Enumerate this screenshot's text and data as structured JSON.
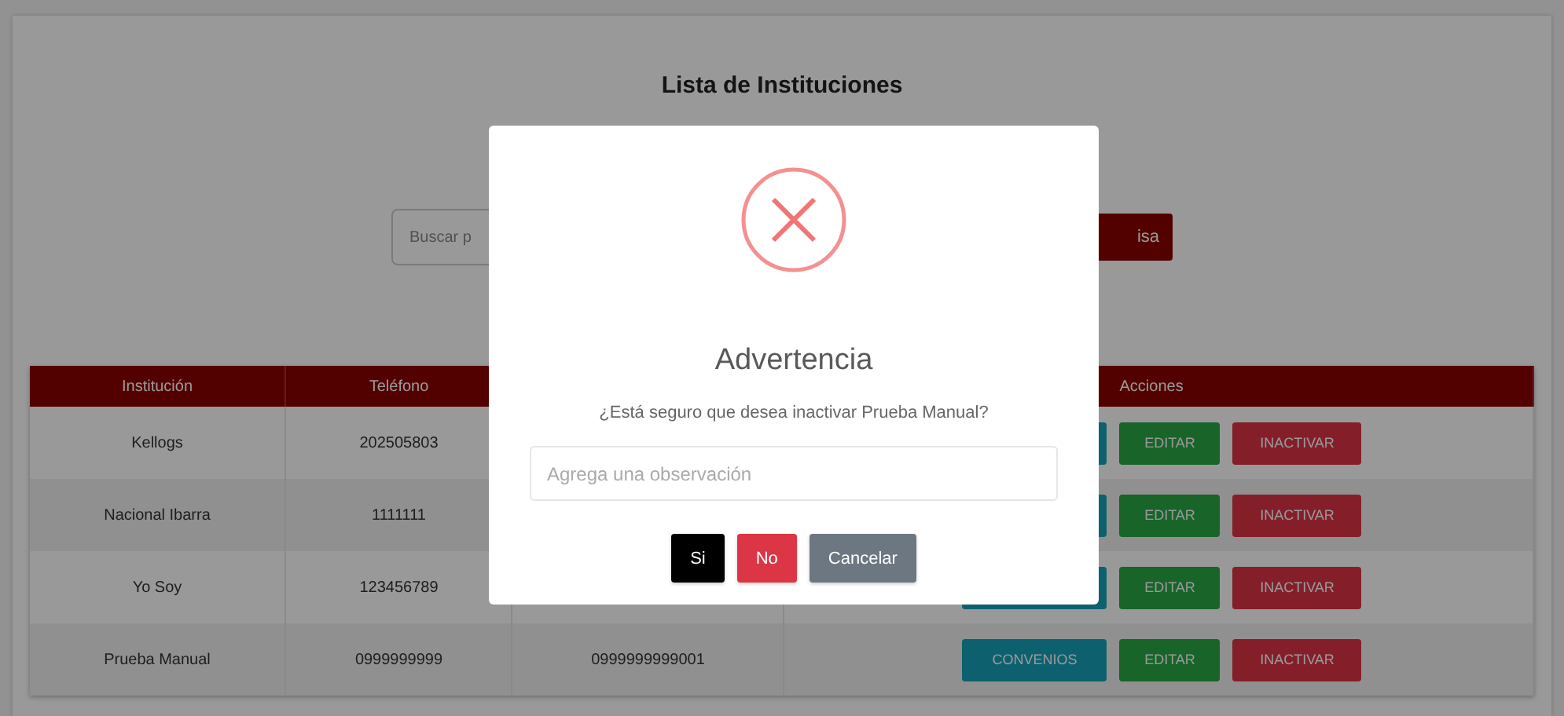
{
  "page": {
    "title": "Lista de Instituciones"
  },
  "search": {
    "placeholder": "Buscar p",
    "button": "isa"
  },
  "table": {
    "columns": [
      "Institución",
      "Teléfono",
      "",
      "Acciones"
    ],
    "rows": [
      {
        "institucion": "Kellogs",
        "telefono": "202505803",
        "column_3": "",
        "has_convenios": true,
        "edit": "EDITAR",
        "inactivate": "INACTIVAR"
      },
      {
        "institucion": "Nacional Ibarra",
        "telefono": "1111111",
        "column_3": "",
        "has_convenios": true,
        "edit": "EDITAR",
        "inactivate": "INACTIVAR"
      },
      {
        "institucion": "Yo Soy",
        "telefono": "123456789",
        "column_3": "",
        "has_convenios": true,
        "edit": "EDITAR",
        "inactivate": "INACTIVAR"
      },
      {
        "institucion": "Prueba Manual",
        "telefono": "0999999999",
        "column_3": "0999999999001",
        "has_convenios": true,
        "convenios_label": "CONVENIOS",
        "edit": "EDITAR",
        "inactivate": "INACTIVAR"
      }
    ]
  },
  "modal": {
    "title": "Advertencia",
    "message": "¿Está seguro que desea inactivar Prueba Manual?",
    "placeholder": "Agrega una observación",
    "buttons": [
      {
        "label": "Si",
        "kind": "confirm"
      },
      {
        "label": "No",
        "kind": "deny"
      },
      {
        "label": "Cancelar",
        "kind": "cancel"
      }
    ]
  }
}
